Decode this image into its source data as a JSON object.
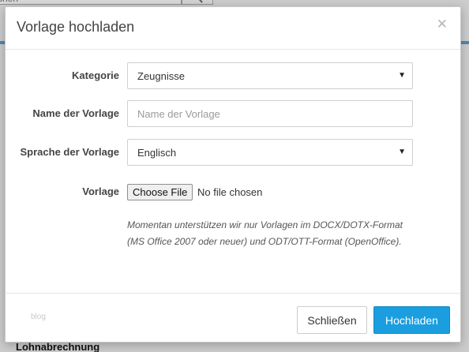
{
  "background": {
    "search_placeholder": "chen",
    "search_icon": "search-icon",
    "bottom_text": "Lohnabrechnung"
  },
  "modal": {
    "title": "Vorlage hochladen",
    "close_icon": "close-icon",
    "fields": {
      "category": {
        "label": "Kategorie",
        "value": "Zeugnisse"
      },
      "name": {
        "label": "Name der Vorlage",
        "placeholder": "Name der Vorlage",
        "value": ""
      },
      "language": {
        "label": "Sprache der Vorlage",
        "value": "Englisch"
      },
      "file": {
        "label": "Vorlage",
        "button": "Choose File",
        "status": "No file chosen"
      }
    },
    "help_text": "Momentan unterstützen wir nur Vorlagen im DOCX/DOTX-Format (MS Office 2007 oder neuer) und ODT/OTT-Format (OpenOffice).",
    "footer": {
      "note": "blog",
      "close_button": "Schließen",
      "upload_button": "Hochladen"
    }
  },
  "colors": {
    "primary": "#1a9ee0",
    "overlay": "#6f6f6f"
  }
}
